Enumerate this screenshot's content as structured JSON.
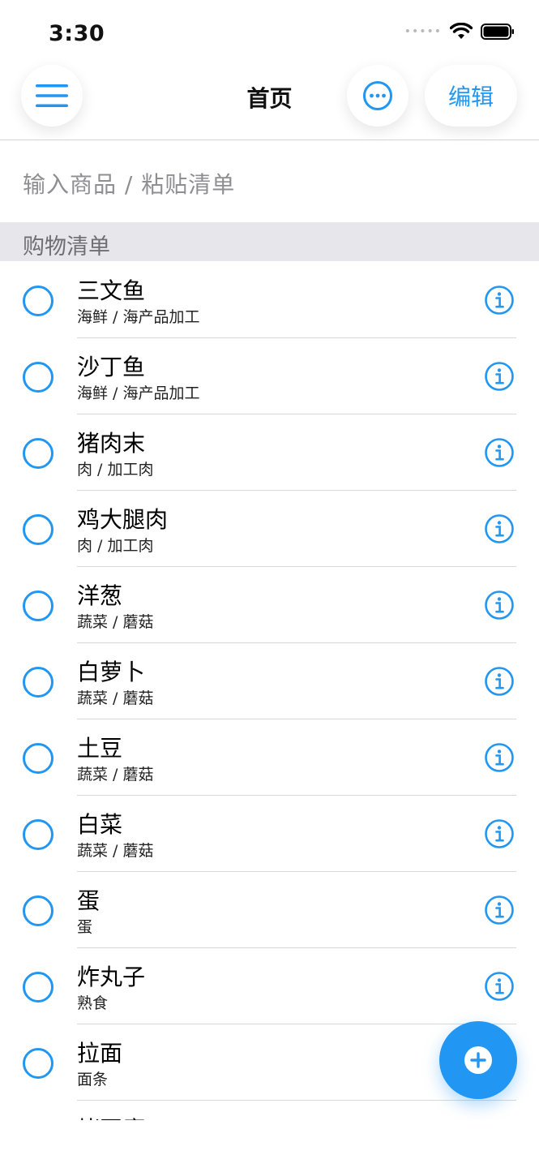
{
  "status_bar": {
    "time": "3:30",
    "signal": "•••••"
  },
  "nav": {
    "title": "首页",
    "edit_label": "编辑"
  },
  "input": {
    "placeholder": "输入商品 / 粘贴清单"
  },
  "section": {
    "title": "购物清单"
  },
  "items": [
    {
      "name": "三文鱼",
      "category": "海鲜 / 海产品加工"
    },
    {
      "name": "沙丁鱼",
      "category": "海鲜 / 海产品加工"
    },
    {
      "name": "猪肉末",
      "category": "肉 / 加工肉"
    },
    {
      "name": "鸡大腿肉",
      "category": "肉 / 加工肉"
    },
    {
      "name": "洋葱",
      "category": "蔬菜 / 蘑菇"
    },
    {
      "name": "白萝卜",
      "category": "蔬菜 / 蘑菇"
    },
    {
      "name": "土豆",
      "category": "蔬菜 / 蘑菇"
    },
    {
      "name": "白菜",
      "category": "蔬菜 / 蘑菇"
    },
    {
      "name": "蛋",
      "category": "蛋"
    },
    {
      "name": "炸丸子",
      "category": "熟食"
    },
    {
      "name": "拉面",
      "category": "面条"
    },
    {
      "name": "烤豆腐",
      "category": ""
    }
  ],
  "colors": {
    "accent": "#2196f3",
    "section_bg": "#e6e6eb",
    "divider": "#d8d8dc"
  },
  "icons": {
    "menu": "hamburger-icon",
    "more": "ellipsis-circle-icon",
    "info": "info-circle-icon",
    "add": "plus-circle-icon"
  }
}
